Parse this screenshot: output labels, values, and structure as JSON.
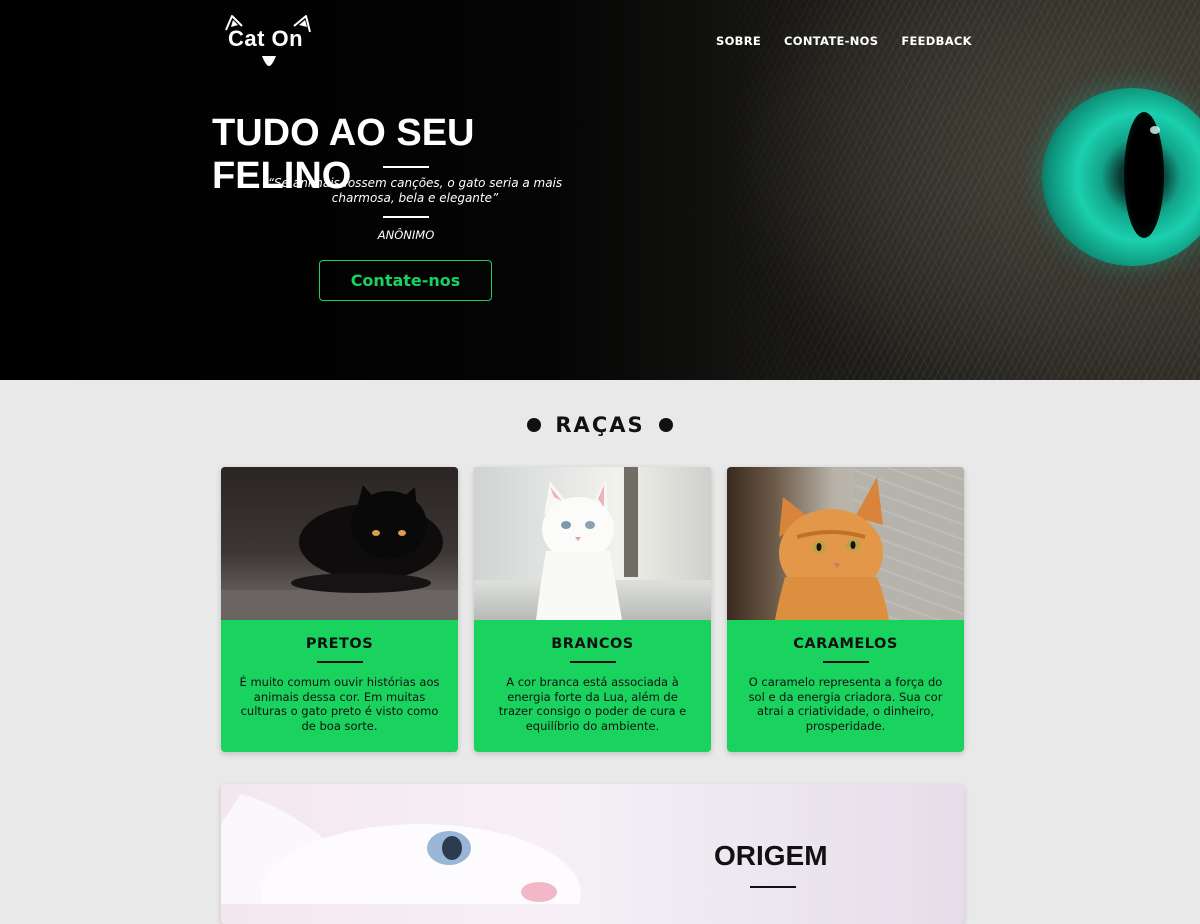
{
  "header": {
    "logo_text": "Cat On",
    "nav": [
      "SOBRE",
      "CONTATE-NOS",
      "FEEDBACK"
    ]
  },
  "hero": {
    "title": "TUDO AO SEU FELINO",
    "quote": "“Se animais fossem canções, o gato seria a mais charmosa, bela e elegante”",
    "author": "ANÔNIMO",
    "cta_label": "Contate-nos"
  },
  "section": {
    "title": "RAÇAS"
  },
  "cards": [
    {
      "title": "PRETOS",
      "text": "É muito comum ouvir histórias aos animais dessa cor. Em muitas culturas o gato preto é visto como de boa sorte."
    },
    {
      "title": "BRANCOS",
      "text": "A cor branca está associada à energia forte da Lua, além de trazer consigo o poder de cura e equilíbrio do ambiente."
    },
    {
      "title": "CARAMELOS",
      "text": "O caramelo representa a força do sol e da energia criadora. Sua cor atrai a criatividade, o dinheiro, prosperidade."
    }
  ],
  "origem": {
    "title": "ORIGEM"
  },
  "colors": {
    "accent_green": "#19d35e",
    "page_bg": "#e9e9e9",
    "eye_teal": "#1bd0ae"
  },
  "icons": [
    "cat-ear-left-icon",
    "cat-ear-right-icon",
    "cat-nose-icon"
  ]
}
